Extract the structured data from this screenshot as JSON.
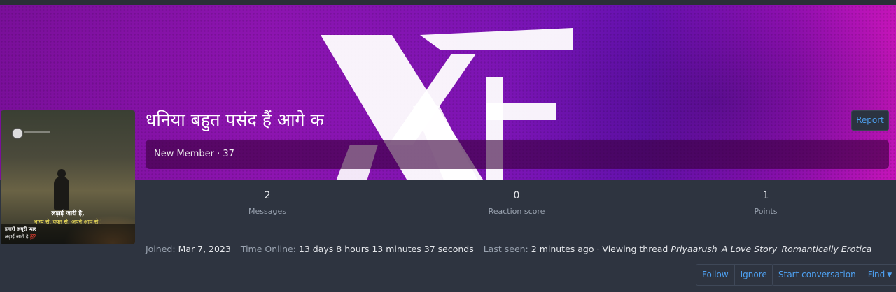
{
  "profile": {
    "username": "धनिया बहुत पसंद हैं आगे क",
    "user_title": "New Member · 37",
    "report_label": "Report",
    "avatar": {
      "line1": "लड़ाई जारी है,",
      "line2": "भाग्य से, वक्त से, अपने आप से !",
      "caption1": "हमारी अधूरी प्यार",
      "caption2": "लड़ाई जारी है 💯"
    }
  },
  "stats": [
    {
      "value": "2",
      "label": "Messages"
    },
    {
      "value": "0",
      "label": "Reaction score"
    },
    {
      "value": "1",
      "label": "Points"
    }
  ],
  "info": {
    "joined_label": "Joined:",
    "joined_value": "Mar 7, 2023",
    "online_label": "Time Online:",
    "online_value": "13 days 8 hours 13 minutes 37 seconds",
    "seen_label": "Last seen:",
    "seen_value": "2 minutes ago · Viewing thread",
    "thread_title": "Priyaarush_A Love Story_Romantically Erotica"
  },
  "actions": {
    "follow": "Follow",
    "ignore": "Ignore",
    "start_conversation": "Start conversation",
    "find": "Find"
  },
  "colors": {
    "page_bg": "#2e3440",
    "link": "#4ea0f0",
    "banner_left": "#7a0f9a",
    "banner_right": "#c414b8"
  }
}
